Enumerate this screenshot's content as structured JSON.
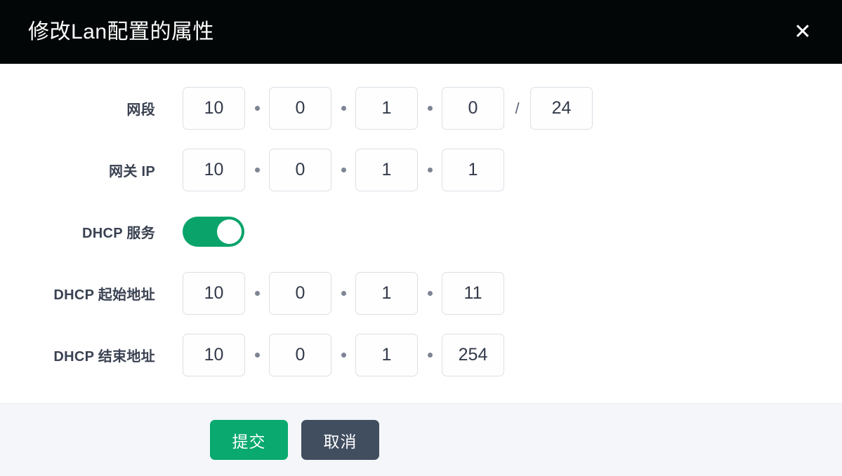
{
  "dialog": {
    "title": "修改Lan配置的属性",
    "close_icon": "close-icon",
    "close_label": "✕"
  },
  "form": {
    "rows": [
      {
        "key": "subnet",
        "label": "网段",
        "type": "ip-cidr",
        "octets": [
          "10",
          "0",
          "1",
          "0"
        ],
        "separator": "·",
        "slash": "/",
        "prefix": "24"
      },
      {
        "key": "gateway",
        "label": "网关 IP",
        "type": "ip",
        "octets": [
          "10",
          "0",
          "1",
          "1"
        ],
        "separator": "·"
      },
      {
        "key": "dhcp_service",
        "label": "DHCP 服务",
        "type": "toggle",
        "enabled": true,
        "on_color": "#0aa46b"
      },
      {
        "key": "dhcp_start",
        "label": "DHCP 起始地址",
        "type": "ip",
        "octets": [
          "10",
          "0",
          "1",
          "11"
        ],
        "separator": "·"
      },
      {
        "key": "dhcp_end",
        "label": "DHCP 结束地址",
        "type": "ip",
        "octets": [
          "10",
          "0",
          "1",
          "254"
        ],
        "separator": "·"
      }
    ]
  },
  "footer": {
    "submit_label": "提交",
    "cancel_label": "取消",
    "submit_color": "#09a96f",
    "cancel_color": "#414e60"
  }
}
